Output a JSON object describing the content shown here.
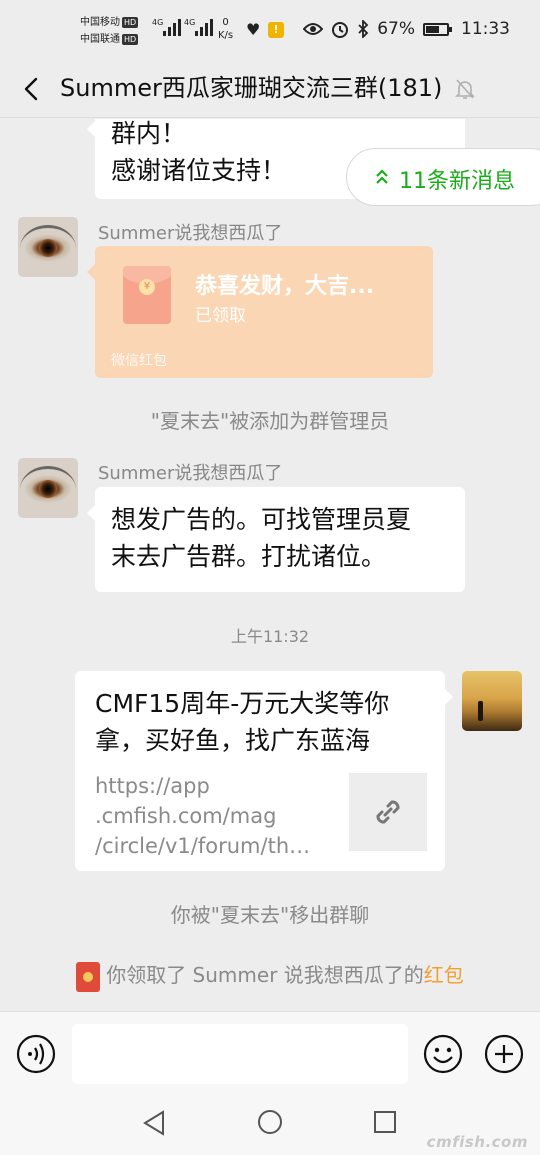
{
  "status_bar": {
    "carrier1": "中国移动",
    "carrier2": "中国联通",
    "hd": "HD",
    "net1": "4G",
    "net2": "4G",
    "speed_value": "0",
    "speed_unit": "K/s",
    "battery_percent": "67%",
    "battery_level": 0.67,
    "time": "11:33",
    "icons": [
      "eye-comfort-icon",
      "alarm-icon",
      "bluetooth-icon",
      "battery-icon",
      "heart-icon",
      "warning-icon"
    ]
  },
  "header": {
    "title": "Summer西瓜家珊瑚交流三群(181)",
    "icons": [
      "back-icon",
      "mute-icon"
    ]
  },
  "new_messages_pill": {
    "label": "11条新消息",
    "color": "#1aad19"
  },
  "messages": [
    {
      "type": "text",
      "lines": [
        "群内！",
        "感谢诸位支持！"
      ]
    },
    {
      "type": "red_packet",
      "sender": "Summer说我想西瓜了",
      "title": "恭喜发财，大吉...",
      "status": "已领取",
      "footer": "微信红包"
    },
    {
      "type": "system",
      "text": "\"夏末去\"被添加为群管理员"
    },
    {
      "type": "text",
      "sender": "Summer说我想西瓜了",
      "lines": [
        "想发广告的。可找管理员夏",
        "末去广告群。打扰诸位。"
      ]
    },
    {
      "type": "time",
      "text": "上午11:32"
    },
    {
      "type": "link",
      "title": "CMF15周年-万元大奖等你拿，买好鱼，找广东蓝海",
      "url": "https://app.cmfish.com/mag/circle/v1/forum/th…",
      "url_lines": [
        "https://app",
        ".cmfish.com/mag",
        "/circle/v1/forum/th…"
      ]
    },
    {
      "type": "system",
      "text": "你被\"夏末去\"移出群聊"
    },
    {
      "type": "system_redpacket",
      "prefix": "你领取了 Summer 说我想西瓜了的",
      "link": "红包",
      "link_color": "#f0a030"
    }
  ],
  "input_bar": {
    "placeholder": "",
    "icons": [
      "voice-icon",
      "emoji-icon",
      "plus-icon"
    ]
  },
  "nav_bar": {
    "icons": [
      "nav-back-icon",
      "nav-home-icon",
      "nav-recent-icon"
    ],
    "watermark": "cmfish.com"
  },
  "colors": {
    "background": "#ededed",
    "bubble": "#ffffff",
    "red_packet": "#fad6b4",
    "accent_green": "#1aad19"
  }
}
